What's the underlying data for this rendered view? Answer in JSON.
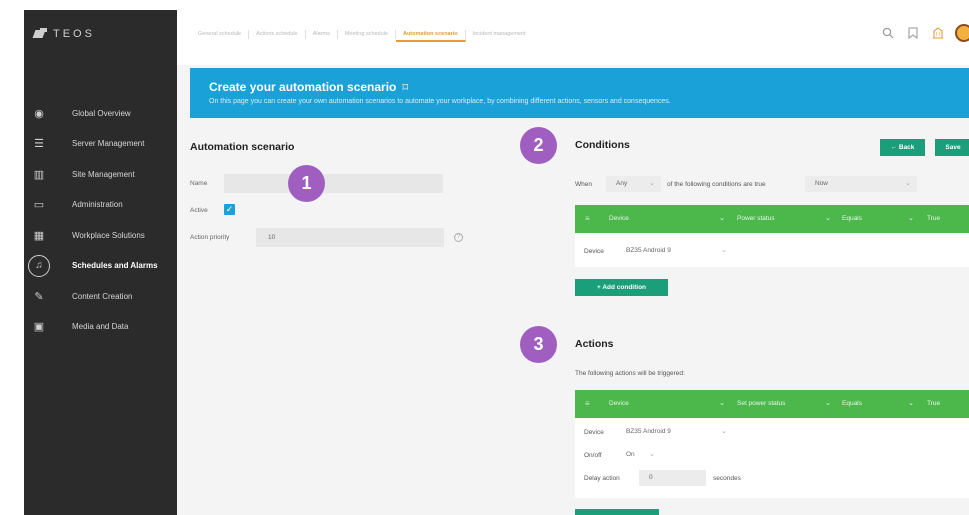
{
  "app": {
    "logo_text": "TEOS"
  },
  "sidebar": {
    "items": [
      {
        "label": "Global Overview",
        "icon": "eye-icon",
        "glyph": "◉"
      },
      {
        "label": "Server Management",
        "icon": "server-icon",
        "glyph": "☰"
      },
      {
        "label": "Site Management",
        "icon": "building-icon",
        "glyph": "▥"
      },
      {
        "label": "Administration",
        "icon": "monitor-icon",
        "glyph": "▭"
      },
      {
        "label": "Workplace Solutions",
        "icon": "grid-icon",
        "glyph": "▦"
      },
      {
        "label": "Schedules and Alarms",
        "icon": "bell-icon",
        "glyph": "♫",
        "active": true
      },
      {
        "label": "Content Creation",
        "icon": "pen-icon",
        "glyph": "✎"
      },
      {
        "label": "Media and Data",
        "icon": "image-icon",
        "glyph": "▣"
      }
    ]
  },
  "tabs": [
    {
      "label": "General schedule"
    },
    {
      "label": "Actions schedule"
    },
    {
      "label": "Alarms"
    },
    {
      "label": "Meeting schedule"
    },
    {
      "label": "Automation scenario",
      "active": true
    },
    {
      "label": "Incident management"
    }
  ],
  "banner": {
    "title": "Create your automation scenario",
    "bookmark_glyph": "⌑",
    "subtitle": "On this page you can create your own automation scenarios to automate your workplace, by combining different actions, sensors and consequences."
  },
  "scenario": {
    "title": "Automation scenario",
    "name_label": "Name",
    "name_value": "",
    "active_label": "Active",
    "active_checked": true,
    "check_glyph": "✓",
    "priority_label": "Action priority",
    "priority_value": "10",
    "info_glyph": "?"
  },
  "markers": [
    "1",
    "2",
    "3"
  ],
  "conditions": {
    "title": "Conditions",
    "back_label": "← Back",
    "save_label": "Save",
    "when_label": "When",
    "when_value": "Any",
    "when_suffix": "of the following conditions are true",
    "time_value": "Now",
    "bar": {
      "type": "Device",
      "property": "Power status",
      "operator": "Equals",
      "value": "True"
    },
    "device_label": "Device",
    "device_value": "BZ35 Android 9",
    "add_label": "+   Add condition"
  },
  "actions": {
    "title": "Actions",
    "intro": "The following actions will be triggered:",
    "bar": {
      "type": "Device",
      "property": "Set power status",
      "operator": "Equals",
      "value": "True"
    },
    "device_label": "Device",
    "device_value": "BZ35 Android 9",
    "onoff_label": "On/off",
    "onoff_value": "On",
    "delay_label": "Delay action",
    "delay_value": "0",
    "delay_unit": "secondes"
  },
  "colors": {
    "banner": "#1aa2d8",
    "accent_orange": "#e79a3c",
    "green_button": "#1b9e7a",
    "green_bar": "#4cb84c",
    "marker": "#a05fc0",
    "sidebar": "#2b2b2b"
  }
}
